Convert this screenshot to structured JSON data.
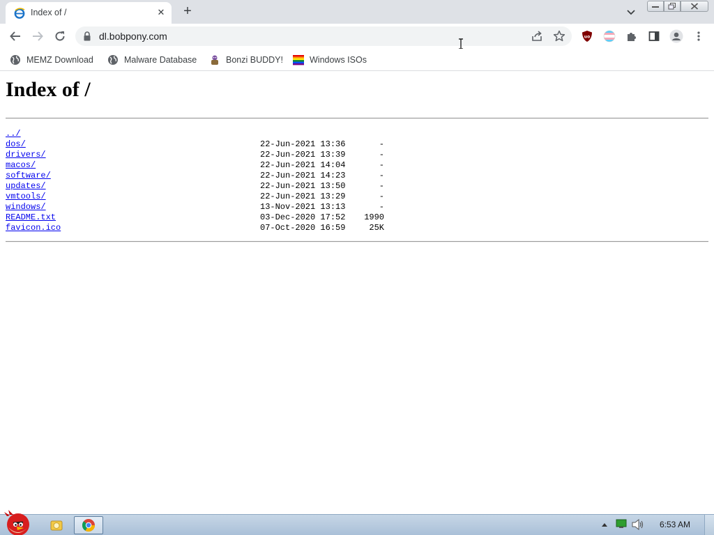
{
  "window": {
    "tab_title": "Index of /",
    "tab_close_symbol": "✕",
    "new_tab_symbol": "+",
    "favicon": "internet-explorer-icon"
  },
  "toolbar": {
    "url": "dl.bobpony.com"
  },
  "bookmarks": [
    {
      "label": "MEMZ Download",
      "icon": "globe-icon"
    },
    {
      "label": "Malware Database",
      "icon": "globe-icon"
    },
    {
      "label": "Bonzi BUDDY!",
      "icon": "bonzi-icon"
    },
    {
      "label": "Windows ISOs",
      "icon": "rainbow-flag-icon"
    }
  ],
  "page": {
    "heading": "Index of /",
    "entries": [
      {
        "name": "../",
        "date": "",
        "size": ""
      },
      {
        "name": "dos/",
        "date": "22-Jun-2021 13:36",
        "size": "-"
      },
      {
        "name": "drivers/",
        "date": "22-Jun-2021 13:39",
        "size": "-"
      },
      {
        "name": "macos/",
        "date": "22-Jun-2021 14:04",
        "size": "-"
      },
      {
        "name": "software/",
        "date": "22-Jun-2021 14:23",
        "size": "-"
      },
      {
        "name": "updates/",
        "date": "22-Jun-2021 13:50",
        "size": "-"
      },
      {
        "name": "vmtools/",
        "date": "22-Jun-2021 13:29",
        "size": "-"
      },
      {
        "name": "windows/",
        "date": "13-Nov-2021 13:13",
        "size": "-"
      },
      {
        "name": "README.txt",
        "date": "03-Dec-2020 17:52",
        "size": "1990"
      },
      {
        "name": "favicon.ico",
        "date": "07-Oct-2020 16:59",
        "size": "25K"
      }
    ]
  },
  "taskbar": {
    "clock": "6:53 AM",
    "start_icon": "angry-bird-icon",
    "apps": [
      {
        "name": "file-explorer-icon",
        "active": false
      },
      {
        "name": "chrome-icon",
        "active": true
      }
    ]
  },
  "colors": {
    "tabstrip_bg": "#dee1e6",
    "link": "#0000ee",
    "taskbar_top": "#c6d6e6",
    "taskbar_bottom": "#aac0d8"
  }
}
